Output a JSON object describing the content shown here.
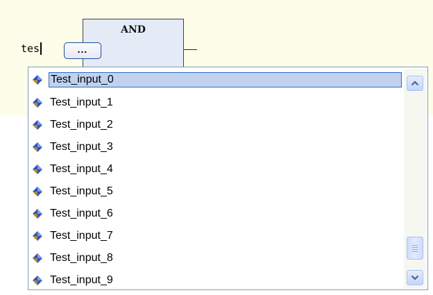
{
  "block": {
    "title": "AND"
  },
  "editor": {
    "typed_text": "tes",
    "browse_button_label": "..."
  },
  "dropdown": {
    "selected_index": 0,
    "items": [
      {
        "label": "Test_input_0"
      },
      {
        "label": "Test_input_1"
      },
      {
        "label": "Test_input_2"
      },
      {
        "label": "Test_input_3"
      },
      {
        "label": "Test_input_4"
      },
      {
        "label": "Test_input_5"
      },
      {
        "label": "Test_input_6"
      },
      {
        "label": "Test_input_7"
      },
      {
        "label": "Test_input_8"
      },
      {
        "label": "Test_input_9"
      }
    ],
    "item_icon": "variable-diamond-icon",
    "scroll_position": 0.85
  },
  "colors": {
    "editor_background": "#fefde9",
    "block_fill": "#e4ebf7",
    "selection_fill": "#c1d2ee",
    "selection_border": "#316ac5",
    "scrollbar_accent": "#a8c1f0"
  }
}
